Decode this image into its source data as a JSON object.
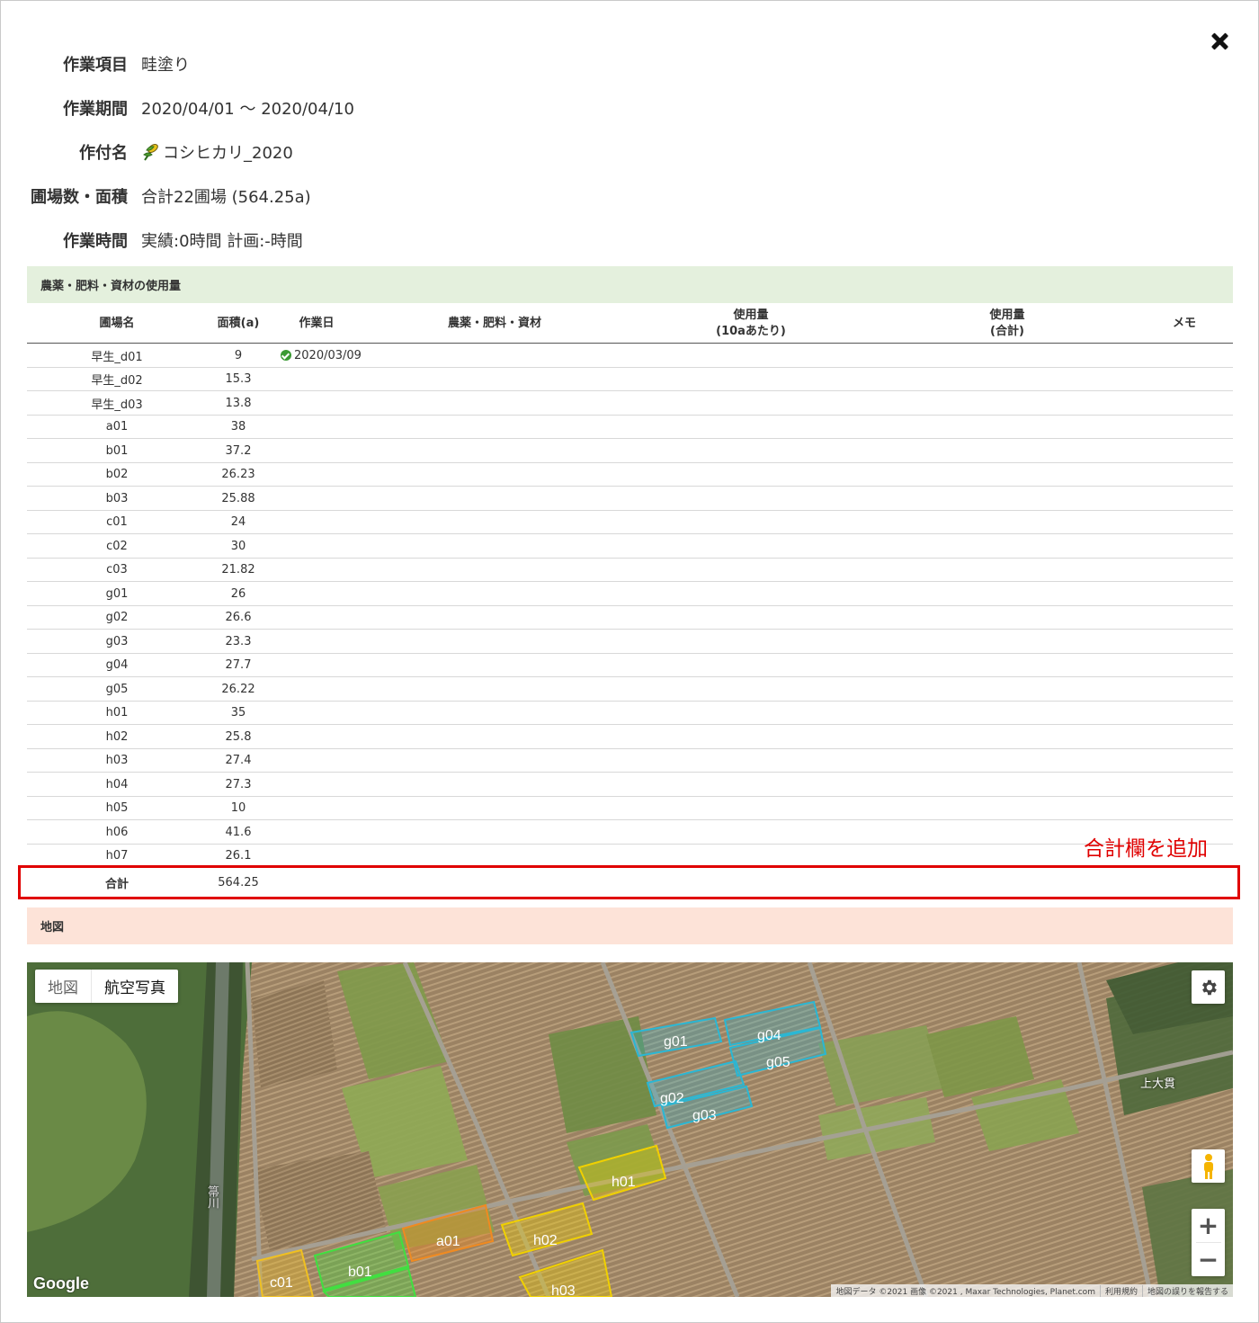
{
  "close_icon": "close-icon",
  "info": {
    "work_item": {
      "label": "作業項目",
      "value": "畦塗り"
    },
    "work_period": {
      "label": "作業期間",
      "value": "2020/04/01 〜 2020/04/10"
    },
    "crop": {
      "label": "作付名",
      "value": "コシヒカリ_2020",
      "icon": "rice-plant-icon"
    },
    "fields": {
      "label": "圃場数・面積",
      "value": "合計22圃場 (564.25a)"
    },
    "work_time": {
      "label": "作業時間",
      "value": "実績:0時間 計画:-時間"
    }
  },
  "usage_section": {
    "title": "農薬・肥料・資材の使用量"
  },
  "table": {
    "headers": {
      "field_name": "圃場名",
      "area": "面積(a)",
      "work_date": "作業日",
      "material": "農薬・肥料・資材",
      "usage_per_10a_line1": "使用量",
      "usage_per_10a_line2": "(10aあたり)",
      "usage_total_line1": "使用量",
      "usage_total_line2": "(合計)",
      "memo": "メモ"
    },
    "rows": [
      {
        "name": "早生_d01",
        "area": "9",
        "date": "2020/03/09"
      },
      {
        "name": "早生_d02",
        "area": "15.3",
        "date": ""
      },
      {
        "name": "早生_d03",
        "area": "13.8",
        "date": ""
      },
      {
        "name": "a01",
        "area": "38",
        "date": ""
      },
      {
        "name": "b01",
        "area": "37.2",
        "date": ""
      },
      {
        "name": "b02",
        "area": "26.23",
        "date": ""
      },
      {
        "name": "b03",
        "area": "25.88",
        "date": ""
      },
      {
        "name": "c01",
        "area": "24",
        "date": ""
      },
      {
        "name": "c02",
        "area": "30",
        "date": ""
      },
      {
        "name": "c03",
        "area": "21.82",
        "date": ""
      },
      {
        "name": "g01",
        "area": "26",
        "date": ""
      },
      {
        "name": "g02",
        "area": "26.6",
        "date": ""
      },
      {
        "name": "g03",
        "area": "23.3",
        "date": ""
      },
      {
        "name": "g04",
        "area": "27.7",
        "date": ""
      },
      {
        "name": "g05",
        "area": "26.22",
        "date": ""
      },
      {
        "name": "h01",
        "area": "35",
        "date": ""
      },
      {
        "name": "h02",
        "area": "25.8",
        "date": ""
      },
      {
        "name": "h03",
        "area": "27.4",
        "date": ""
      },
      {
        "name": "h04",
        "area": "27.3",
        "date": ""
      },
      {
        "name": "h05",
        "area": "10",
        "date": ""
      },
      {
        "name": "h06",
        "area": "41.6",
        "date": ""
      },
      {
        "name": "h07",
        "area": "26.1",
        "date": ""
      }
    ],
    "total": {
      "label": "合計",
      "area": "564.25"
    }
  },
  "annotation": {
    "text": "合計欄を追加",
    "color": "#e00000"
  },
  "map_section": {
    "title": "地図"
  },
  "map": {
    "type_buttons": {
      "map": "地図",
      "satellite": "航空写真"
    },
    "field_labels": {
      "g01": "g01",
      "g02": "g02",
      "g03": "g03",
      "g04": "g04",
      "g05": "g05",
      "h01": "h01",
      "h02": "h02",
      "h03": "h03",
      "a01": "a01",
      "b01": "b01",
      "c01": "c01"
    },
    "place_label": "上大貫",
    "river_label": "箒川",
    "zoom_in": "+",
    "zoom_out": "−",
    "google": "Google",
    "attribution": [
      "地図データ ©2021 画像 ©2021 , Maxar Technologies, Planet.com",
      "利用規約",
      "地図の誤りを報告する"
    ],
    "colors": {
      "g_group": "#2ab7d4",
      "h_group": "#f0d000",
      "a_group": "#f08a20",
      "b_group": "#40e040",
      "c_group": "#f0c020"
    }
  }
}
